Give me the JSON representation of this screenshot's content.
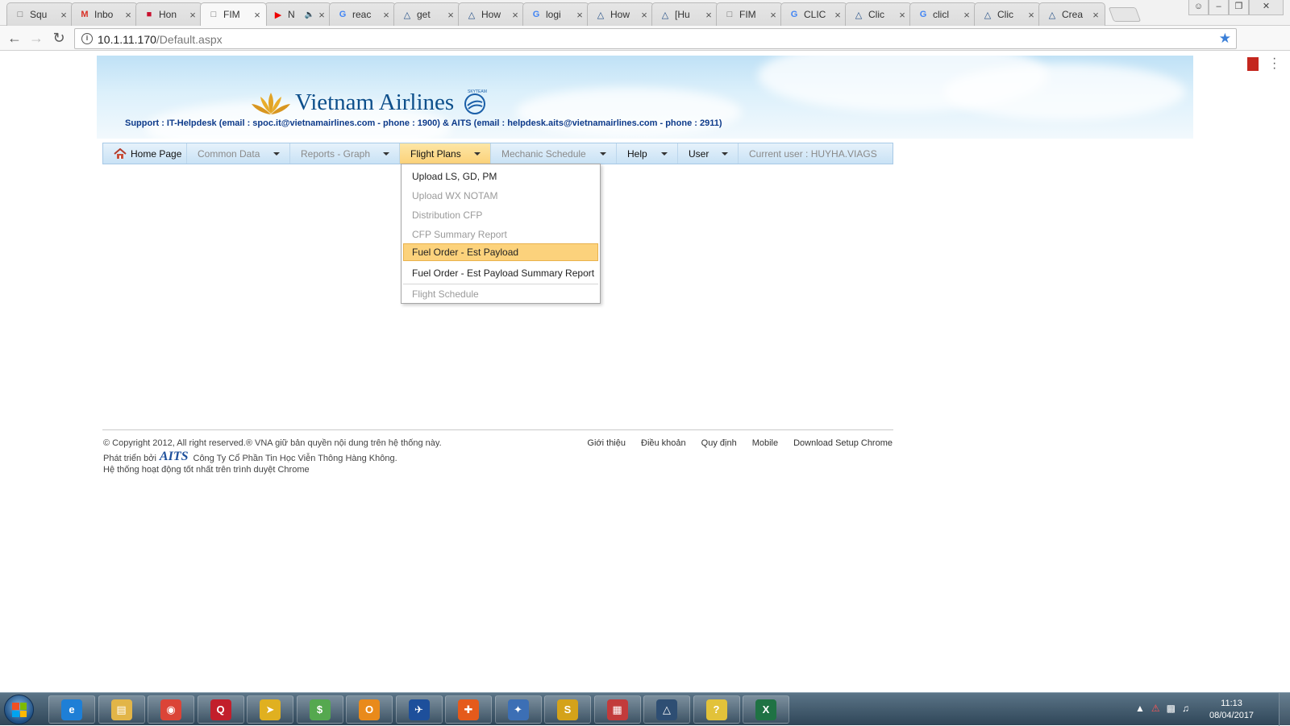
{
  "browser": {
    "tabs": [
      {
        "title": "Squ",
        "icon": "document-icon"
      },
      {
        "title": "Inbo",
        "icon": "gmail-icon"
      },
      {
        "title": "Hon",
        "icon": "flag-icon"
      },
      {
        "title": "FIM",
        "icon": "document-icon",
        "active": true
      },
      {
        "title": "N",
        "icon": "youtube-icon",
        "audio": true
      },
      {
        "title": "reac",
        "icon": "google-icon"
      },
      {
        "title": "get",
        "icon": "app-icon"
      },
      {
        "title": "How",
        "icon": "app-icon"
      },
      {
        "title": "logi",
        "icon": "google-icon"
      },
      {
        "title": "How",
        "icon": "app-icon"
      },
      {
        "title": "[Hu",
        "icon": "app-icon"
      },
      {
        "title": "FIM",
        "icon": "document-icon"
      },
      {
        "title": "CLIC",
        "icon": "google-icon"
      },
      {
        "title": "Clic",
        "icon": "app-icon"
      },
      {
        "title": "clicl",
        "icon": "google-icon"
      },
      {
        "title": "Clic",
        "icon": "app-icon"
      },
      {
        "title": "Crea",
        "icon": "app-icon"
      }
    ],
    "url_host": "10.1.11.170",
    "url_path": "/Default.aspx"
  },
  "header": {
    "logo_text": "Vietnam Airlines",
    "logo_badge": "SKYTEAM",
    "support": "Support : IT-Helpdesk (email : spoc.it@vietnamairlines.com - phone : 1900) & AITS (email : helpdesk.aits@vietnamairlines.com - phone : 2911)"
  },
  "nav": {
    "home": "Home Page",
    "common_data": "Common Data",
    "reports": "Reports - Graph",
    "flight_plans": "Flight Plans",
    "mechanic": "Mechanic Schedule",
    "help": "Help",
    "user": "User",
    "current_user": "Current user : HUYHA.VIAGS"
  },
  "dropdown": {
    "items": [
      {
        "label": "Upload LS, GD, PM",
        "enabled": true
      },
      {
        "label": "Upload WX NOTAM",
        "enabled": false
      },
      {
        "label": "Distribution CFP",
        "enabled": false
      },
      {
        "label": "CFP Summary Report",
        "enabled": false
      },
      {
        "label": "Fuel Order - Est Payload",
        "enabled": true,
        "hover": true
      },
      {
        "label": "Fuel Order - Est Payload Summary Report",
        "enabled": true
      },
      {
        "label": "Flight Schedule",
        "enabled": false
      }
    ]
  },
  "footer": {
    "copyright": "© Copyright 2012, All right reserved.® VNA giữ bản quyền nội dung trên hệ thống này.",
    "dev_prefix": "Phát triển bởi",
    "dev_logo": "AITS",
    "dev_company": "Công Ty Cổ Phần Tin Học Viễn Thông Hàng Không.",
    "recommend": "Hệ thống hoạt động tốt nhất trên trình duyệt Chrome",
    "links": [
      "Giới thiệu",
      "Điều khoản",
      "Quy định",
      "Mobile",
      "Download Setup Chrome"
    ]
  },
  "taskbar": {
    "apps": [
      "ie-icon",
      "folder-icon",
      "chrome-icon",
      "qlik-icon",
      "paper-plane-icon",
      "money-icon",
      "outlook-icon",
      "airplane-icon",
      "runner-icon",
      "compass-icon",
      "skyteam-icon",
      "planner-icon",
      "aviation-icon",
      "help-icon",
      "excel-icon"
    ],
    "time": "11:13",
    "date": "08/04/2017"
  },
  "colors": {
    "brand_blue": "#0d4f8b",
    "menu_highlight": "#fcd27c",
    "taskbar": "#3b5366"
  }
}
